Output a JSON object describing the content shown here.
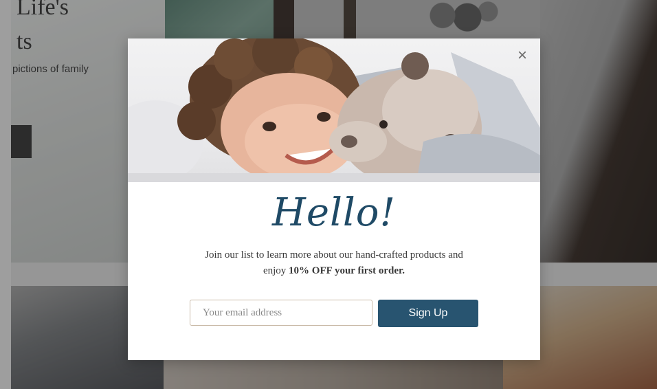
{
  "background_page": {
    "hero_title_line1": "Life's",
    "hero_title_line2": "ts",
    "hero_subtitle": "pictions of family"
  },
  "popup": {
    "image_alt": "smiling child hugging teddy bear",
    "close_icon": "close-icon",
    "heading": "Hello!",
    "body_text": "Join our list to learn more about our hand-crafted products and enjoy ",
    "body_bold": "10% OFF your first order.",
    "email_placeholder": "Your email address",
    "email_value": "",
    "signup_label": "Sign Up"
  },
  "colors": {
    "accent": "#285470",
    "heading": "#1f4a66",
    "input_border": "#c9b9a7"
  }
}
